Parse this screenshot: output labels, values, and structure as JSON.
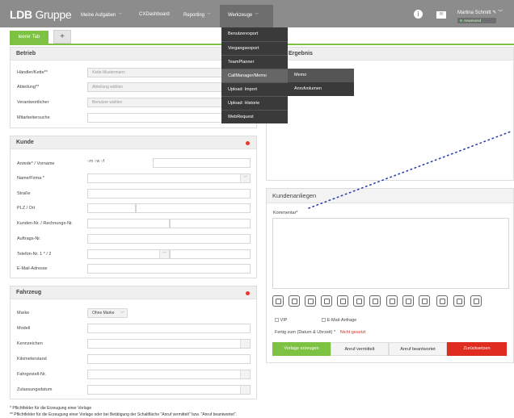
{
  "header": {
    "logo_bold": "LDB",
    "logo_rest": " Gruppe",
    "nav": [
      {
        "label": "Meine Aufgaben"
      },
      {
        "label": "CXDashboard"
      },
      {
        "label": "Reporting"
      },
      {
        "label": "Werkzeuge"
      }
    ],
    "user_name": "Martina Schmitt",
    "user_status": "Anwesend",
    "info_icon": "i",
    "mail_icon": "✉"
  },
  "tabs": {
    "active": "leerer Tab",
    "add": "+"
  },
  "menu": {
    "items": [
      "Benutzerexport",
      "Vorgangsexport",
      "TeamPlanner",
      "CallManager/Memo",
      "Upload: Import",
      "Upload: Historie",
      "WebRequest"
    ],
    "sub": [
      "Memo",
      "Anrufvolumen"
    ]
  },
  "betrieb": {
    "title": "Betrieb",
    "fields": [
      {
        "label": "Händler/Kette**",
        "placeholder": "Kette Mustermann"
      },
      {
        "label": "Abteilung**",
        "placeholder": "Abteilung wählen"
      },
      {
        "label": "Verantwortlicher",
        "placeholder": "Benutzer wählen"
      },
      {
        "label": "Mitarbeitersuche",
        "placeholder": ""
      }
    ]
  },
  "ergebnis": {
    "title": "Ergebnis"
  },
  "kunde": {
    "title": "Kunde",
    "fields": [
      "Anrede* / Vorname",
      "Name/Firma *",
      "Straße",
      "PLZ / Ort",
      "Kunden-Nr. / Rechnungs-Nr.",
      "Auftrags-Nr.",
      "Telefon-Nr. 1 * / 2",
      "E-Mail-Adresse"
    ],
    "radios": [
      "m",
      "w",
      "f"
    ]
  },
  "fahrzeug": {
    "title": "Fahrzeug",
    "fields": [
      "Marke",
      "Modell",
      "Kennzeichen",
      "Kilometerstand",
      "Fahrgestell-Nr.",
      "Zulassungsdatum"
    ],
    "marke_value": "Ohne Marke"
  },
  "anliegen": {
    "title": "Kundenanliegen",
    "comment_label": "Kommentar*",
    "vip_label": "VIP",
    "email_label": "E-Mail-Anfrage",
    "due_label": "Fertig zum (Datum & Uhrzeit) *",
    "due_value": "Nicht gesetzt",
    "icons": [
      "phone-icon",
      "calendar-icon",
      "chat-icon",
      "pencil-icon",
      "at-icon",
      "steering-icon",
      "car-icon",
      "letter-c-icon",
      "info-icon",
      "id-card-icon",
      "copy-icon",
      "target-icon",
      "warning-icon"
    ],
    "buttons": [
      "Vorlage erzeugen",
      "Anruf vermittelt",
      "Anruf beantwortet",
      "Zurücksetzen"
    ]
  },
  "footer": {
    "note1": "* Pflichtfelder für die Erzeugung einer Vorlage",
    "note2": "** Pflichtfelder für die Erzeugung einer Vorlage oder bei Betätigung der Schaltfläche \"Anruf vermittelt\" bzw. \"Anruf beantwortet\"."
  },
  "colors": {
    "accent_green": "#7dc243",
    "danger_red": "#e02b20",
    "header_gray": "#8c8c8c"
  }
}
